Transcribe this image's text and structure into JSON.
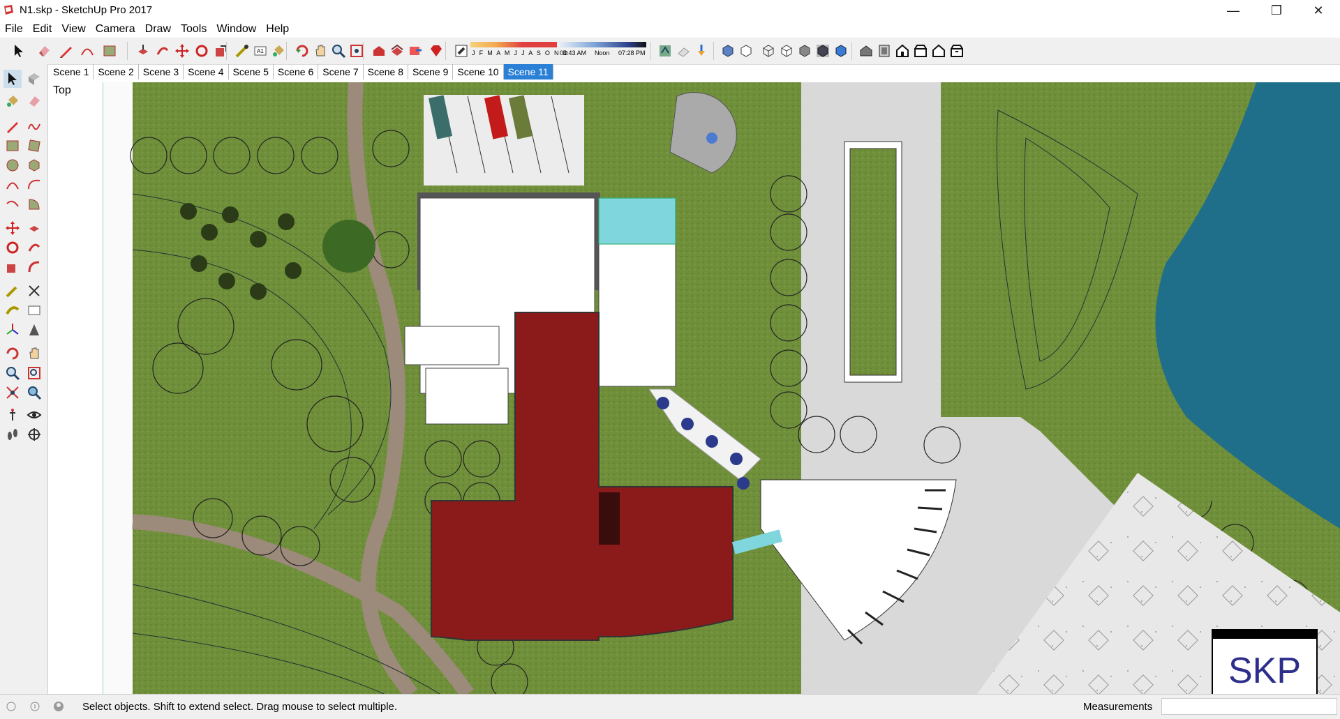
{
  "window": {
    "title": "N1.skp - SketchUp Pro 2017",
    "minimize_glyph": "—",
    "restore_glyph": "❐",
    "close_glyph": "✕"
  },
  "menu": [
    "File",
    "Edit",
    "View",
    "Camera",
    "Draw",
    "Tools",
    "Window",
    "Help"
  ],
  "shadow_settings": {
    "months": "J F M A M J J A S O N D",
    "time_start": "04:43 AM",
    "time_noon": "Noon",
    "time_end": "07:28 PM"
  },
  "scenes": [
    "Scene 1",
    "Scene 2",
    "Scene 3",
    "Scene 4",
    "Scene 5",
    "Scene 6",
    "Scene 7",
    "Scene 8",
    "Scene 9",
    "Scene 10",
    "Scene 11"
  ],
  "active_scene": "Scene 11",
  "view": {
    "label": "Top"
  },
  "status": {
    "message": "Select objects. Shift to extend select. Drag mouse to select multiple.",
    "measurements_label": "Measurements",
    "measurements_value": ""
  },
  "watermark": {
    "text": "SKP"
  },
  "colors": {
    "grass": "#6f8f3a",
    "path": "#9c8a7a",
    "roof_red": "#8b1a1a",
    "water": "#1f6f8b",
    "pavement": "#d9d9d9",
    "glass": "#7fd6dc",
    "accent": "#2a7fd6"
  }
}
